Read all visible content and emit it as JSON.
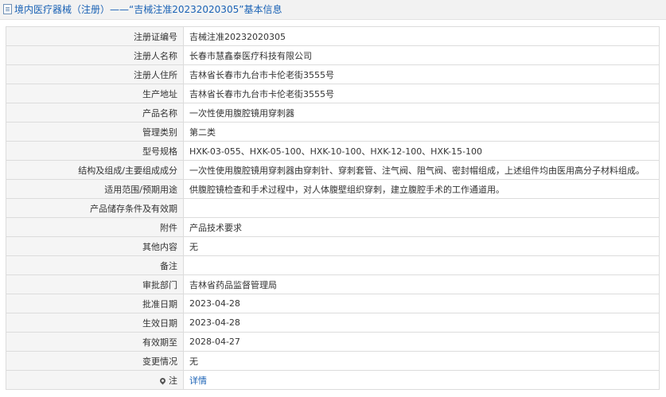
{
  "header": {
    "prefix": "境内医疗器械（注册）",
    "separator": "——",
    "cert_title": "“吉械注准20232020305”",
    "suffix": "基本信息"
  },
  "rows": [
    {
      "label": "注册证编号",
      "value": "吉械注准20232020305"
    },
    {
      "label": "注册人名称",
      "value": "长春市慧鑫泰医疗科技有限公司"
    },
    {
      "label": "注册人住所",
      "value": "吉林省长春市九台市卡伦老街3555号"
    },
    {
      "label": "生产地址",
      "value": "吉林省长春市九台市卡伦老街3555号"
    },
    {
      "label": "产品名称",
      "value": "一次性使用腹腔镜用穿刺器"
    },
    {
      "label": "管理类别",
      "value": "第二类"
    },
    {
      "label": "型号规格",
      "value": "HXK-03-055、HXK-05-100、HXK-10-100、HXK-12-100、HXK-15-100"
    },
    {
      "label": "结构及组成/主要组成成分",
      "value": "一次性使用腹腔镜用穿刺器由穿刺针、穿刺套管、注气阀、阻气阀、密封帽组成，上述组件均由医用高分子材料组成。"
    },
    {
      "label": "适用范围/预期用途",
      "value": "供腹腔镜检查和手术过程中，对人体腹壁组织穿刺，建立腹腔手术的工作通道用。"
    },
    {
      "label": "产品储存条件及有效期",
      "value": ""
    },
    {
      "label": "附件",
      "value": "产品技术要求"
    },
    {
      "label": "其他内容",
      "value": "无"
    },
    {
      "label": "备注",
      "value": ""
    },
    {
      "label": "审批部门",
      "value": "吉林省药品监督管理局"
    },
    {
      "label": "批准日期",
      "value": "2023-04-28"
    },
    {
      "label": "生效日期",
      "value": "2023-04-28"
    },
    {
      "label": "有效期至",
      "value": "2028-04-27"
    },
    {
      "label": "变更情况",
      "value": "无"
    }
  ],
  "note_row": {
    "label": "注",
    "link": "详情",
    "icon": "location-pin-icon"
  }
}
